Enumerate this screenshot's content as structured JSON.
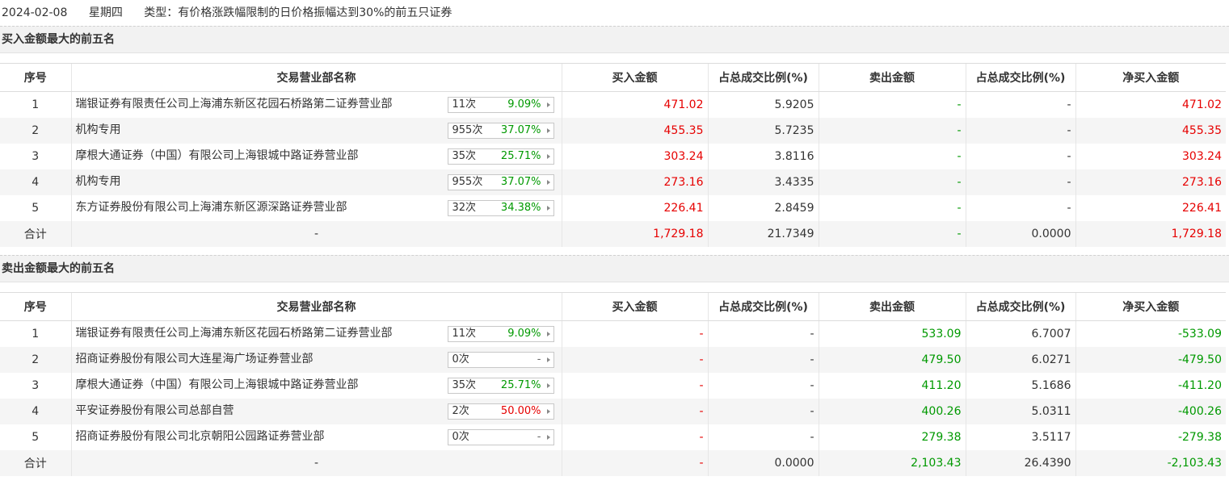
{
  "info": {
    "date": "2024-02-08",
    "weekday": "星期四",
    "type_label": "类型：有价格涨跌幅限制的日价格振幅达到30%的前五只证券"
  },
  "headers": [
    "序号",
    "交易营业部名称",
    "买入金额",
    "占总成交比例(%)",
    "卖出金额",
    "占总成交比例(%)",
    "净买入金额"
  ],
  "buy_section": {
    "title": "买入金额最大的前五名",
    "rows": [
      {
        "idx": "1",
        "name": "瑞银证券有限责任公司上海浦东新区花园石桥路第二证券营业部",
        "times": "11次",
        "rate": "9.09%",
        "rate_level": "up",
        "buy": "471.02",
        "buy_pct": "5.9205",
        "sell": "-",
        "sell_pct": "-",
        "net": "471.02"
      },
      {
        "idx": "2",
        "name": "机构专用",
        "times": "955次",
        "rate": "37.07%",
        "rate_level": "up",
        "buy": "455.35",
        "buy_pct": "5.7235",
        "sell": "-",
        "sell_pct": "-",
        "net": "455.35"
      },
      {
        "idx": "3",
        "name": "摩根大通证券（中国）有限公司上海银城中路证券营业部",
        "times": "35次",
        "rate": "25.71%",
        "rate_level": "up",
        "buy": "303.24",
        "buy_pct": "3.8116",
        "sell": "-",
        "sell_pct": "-",
        "net": "303.24"
      },
      {
        "idx": "4",
        "name": "机构专用",
        "times": "955次",
        "rate": "37.07%",
        "rate_level": "up",
        "buy": "273.16",
        "buy_pct": "3.4335",
        "sell": "-",
        "sell_pct": "-",
        "net": "273.16"
      },
      {
        "idx": "5",
        "name": "东方证券股份有限公司上海浦东新区源深路证券营业部",
        "times": "32次",
        "rate": "34.38%",
        "rate_level": "up",
        "buy": "226.41",
        "buy_pct": "2.8459",
        "sell": "-",
        "sell_pct": "-",
        "net": "226.41"
      }
    ],
    "total": {
      "label": "合计",
      "name": "-",
      "buy": "1,729.18",
      "buy_pct": "21.7349",
      "sell": "-",
      "sell_pct": "0.0000",
      "net": "1,729.18"
    }
  },
  "sell_section": {
    "title": "卖出金额最大的前五名",
    "rows": [
      {
        "idx": "1",
        "name": "瑞银证券有限责任公司上海浦东新区花园石桥路第二证券营业部",
        "times": "11次",
        "rate": "9.09%",
        "rate_level": "up",
        "buy": "-",
        "buy_pct": "-",
        "sell": "533.09",
        "sell_pct": "6.7007",
        "net": "-533.09"
      },
      {
        "idx": "2",
        "name": "招商证券股份有限公司大连星海广场证券营业部",
        "times": "0次",
        "rate": "-",
        "rate_level": "none",
        "buy": "-",
        "buy_pct": "-",
        "sell": "479.50",
        "sell_pct": "6.0271",
        "net": "-479.50"
      },
      {
        "idx": "3",
        "name": "摩根大通证券（中国）有限公司上海银城中路证券营业部",
        "times": "35次",
        "rate": "25.71%",
        "rate_level": "up",
        "buy": "-",
        "buy_pct": "-",
        "sell": "411.20",
        "sell_pct": "5.1686",
        "net": "-411.20"
      },
      {
        "idx": "4",
        "name": "平安证券股份有限公司总部自营",
        "times": "2次",
        "rate": "50.00%",
        "rate_level": "hi",
        "buy": "-",
        "buy_pct": "-",
        "sell": "400.26",
        "sell_pct": "5.0311",
        "net": "-400.26"
      },
      {
        "idx": "5",
        "name": "招商证券股份有限公司北京朝阳公园路证券营业部",
        "times": "0次",
        "rate": "-",
        "rate_level": "none",
        "buy": "-",
        "buy_pct": "-",
        "sell": "279.38",
        "sell_pct": "3.5117",
        "net": "-279.38"
      }
    ],
    "total": {
      "label": "合计",
      "name": "-",
      "buy": "-",
      "buy_pct": "0.0000",
      "sell": "2,103.43",
      "sell_pct": "26.4390",
      "net": "-2,103.43"
    }
  },
  "colors": {
    "rise": "#e60000",
    "fall": "#009900",
    "stripe": "#f5f5f5"
  }
}
